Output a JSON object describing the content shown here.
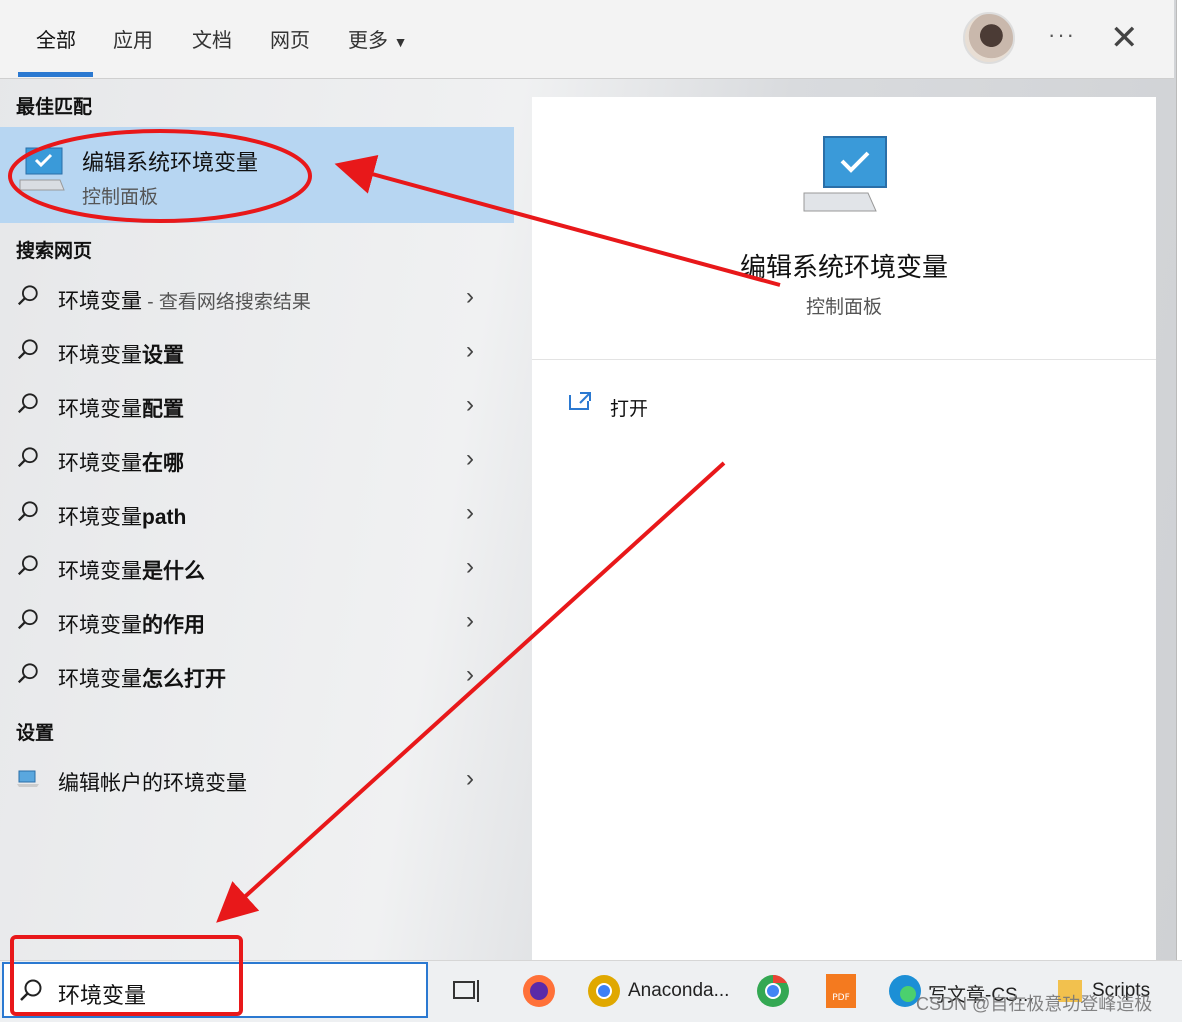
{
  "tabs": {
    "all": "全部",
    "apps": "应用",
    "docs": "文档",
    "web": "网页",
    "more": "更多"
  },
  "sections": {
    "best": "最佳匹配",
    "web": "搜索网页",
    "settings": "设置"
  },
  "best_match": {
    "title": "编辑系统环境变量",
    "subtitle": "控制面板"
  },
  "web_results": [
    {
      "prefix": "环境变量",
      "hint": " - 查看网络搜索结果",
      "bold": ""
    },
    {
      "prefix": "环境变量",
      "hint": "",
      "bold": "设置"
    },
    {
      "prefix": "环境变量",
      "hint": "",
      "bold": "配置"
    },
    {
      "prefix": "环境变量",
      "hint": "",
      "bold": "在哪"
    },
    {
      "prefix": "环境变量",
      "hint": "",
      "bold": "path"
    },
    {
      "prefix": "环境变量",
      "hint": "",
      "bold": "是什么"
    },
    {
      "prefix": "环境变量",
      "hint": "",
      "bold": "的作用"
    },
    {
      "prefix": "环境变量",
      "hint": "",
      "bold": "怎么打开"
    }
  ],
  "settings_result": {
    "label": "编辑帐户的环境变量"
  },
  "preview": {
    "title": "编辑系统环境变量",
    "subtitle": "控制面板",
    "open_label": "打开"
  },
  "search": {
    "value": "环境变量"
  },
  "taskbar": {
    "anaconda": "Anaconda...",
    "write": "写文章-CS...",
    "scripts": "Scripts"
  },
  "watermark": "CSDN @自在极意功登峰造极",
  "colors": {
    "accent": "#2b79d1",
    "selected_bg": "#b7d6f2",
    "annotation": "#e8181a"
  },
  "icons": {
    "search": "search-icon",
    "chevron": "chevron-right-icon",
    "monitor": "monitor-check-icon",
    "open": "open-external-icon"
  }
}
